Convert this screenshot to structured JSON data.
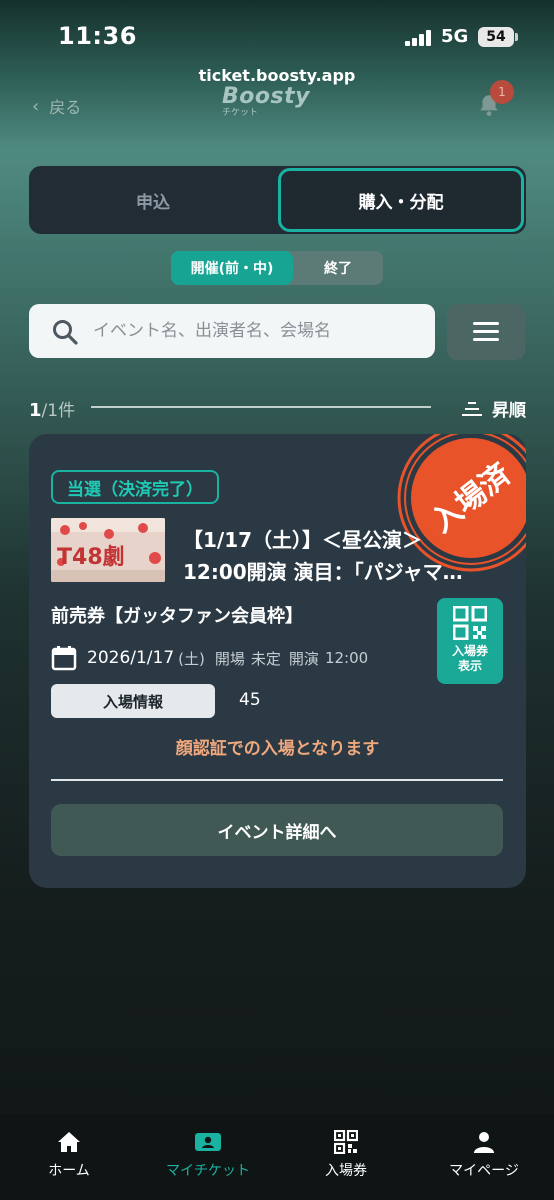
{
  "status_bar": {
    "time": "11:36",
    "network": "5G",
    "battery": "54"
  },
  "browser": {
    "url": "ticket.boosty.app"
  },
  "nav": {
    "back_label": "戻る",
    "logo_text": "Boosty",
    "logo_sub": "チケット",
    "notification_count": "1"
  },
  "segments": {
    "left_label": "申込",
    "right_label": "購入・分配",
    "selected": "購入・分配"
  },
  "filter_toggle": {
    "active_label": "開催(前・中)",
    "inactive_label": "終了"
  },
  "search": {
    "placeholder": "イベント名、出演者名、会場名",
    "value": ""
  },
  "results": {
    "count_current": "1",
    "count_total": "/1件",
    "sort_label": "昇順"
  },
  "ticket": {
    "stamp_label": "入場済",
    "status_badge": "当選（決済完了）",
    "thumbnail_text": "T48劇",
    "title_line1": "【1/17（土）】＜昼公演＞",
    "title_line2": "12:00開演 演目：「パジャマ…",
    "ticket_type": "前売券【ガッタファン会員枠】",
    "date": "2026/1/17",
    "day": "(土)",
    "open_label": "開場",
    "open_value": "未定",
    "start_label": "開演",
    "start_value": "12:00",
    "qr_label": "入場券\n表示",
    "entry_info_label": "入場情報",
    "entry_number": "45",
    "notice": "顔認証での入場となります",
    "detail_button": "イベント詳細へ"
  },
  "tabbar": {
    "items": [
      {
        "label": "ホーム",
        "icon": "home-icon"
      },
      {
        "label": "マイチケット",
        "icon": "ticket-icon"
      },
      {
        "label": "入場券",
        "icon": "qr-code-icon"
      },
      {
        "label": "マイページ",
        "icon": "person-icon"
      }
    ],
    "active": "マイチケット"
  },
  "colors": {
    "accent": "#1ab2a0",
    "stamp": "#e8532a",
    "notice": "#f0a87d",
    "card_bg": "#2b3944"
  }
}
